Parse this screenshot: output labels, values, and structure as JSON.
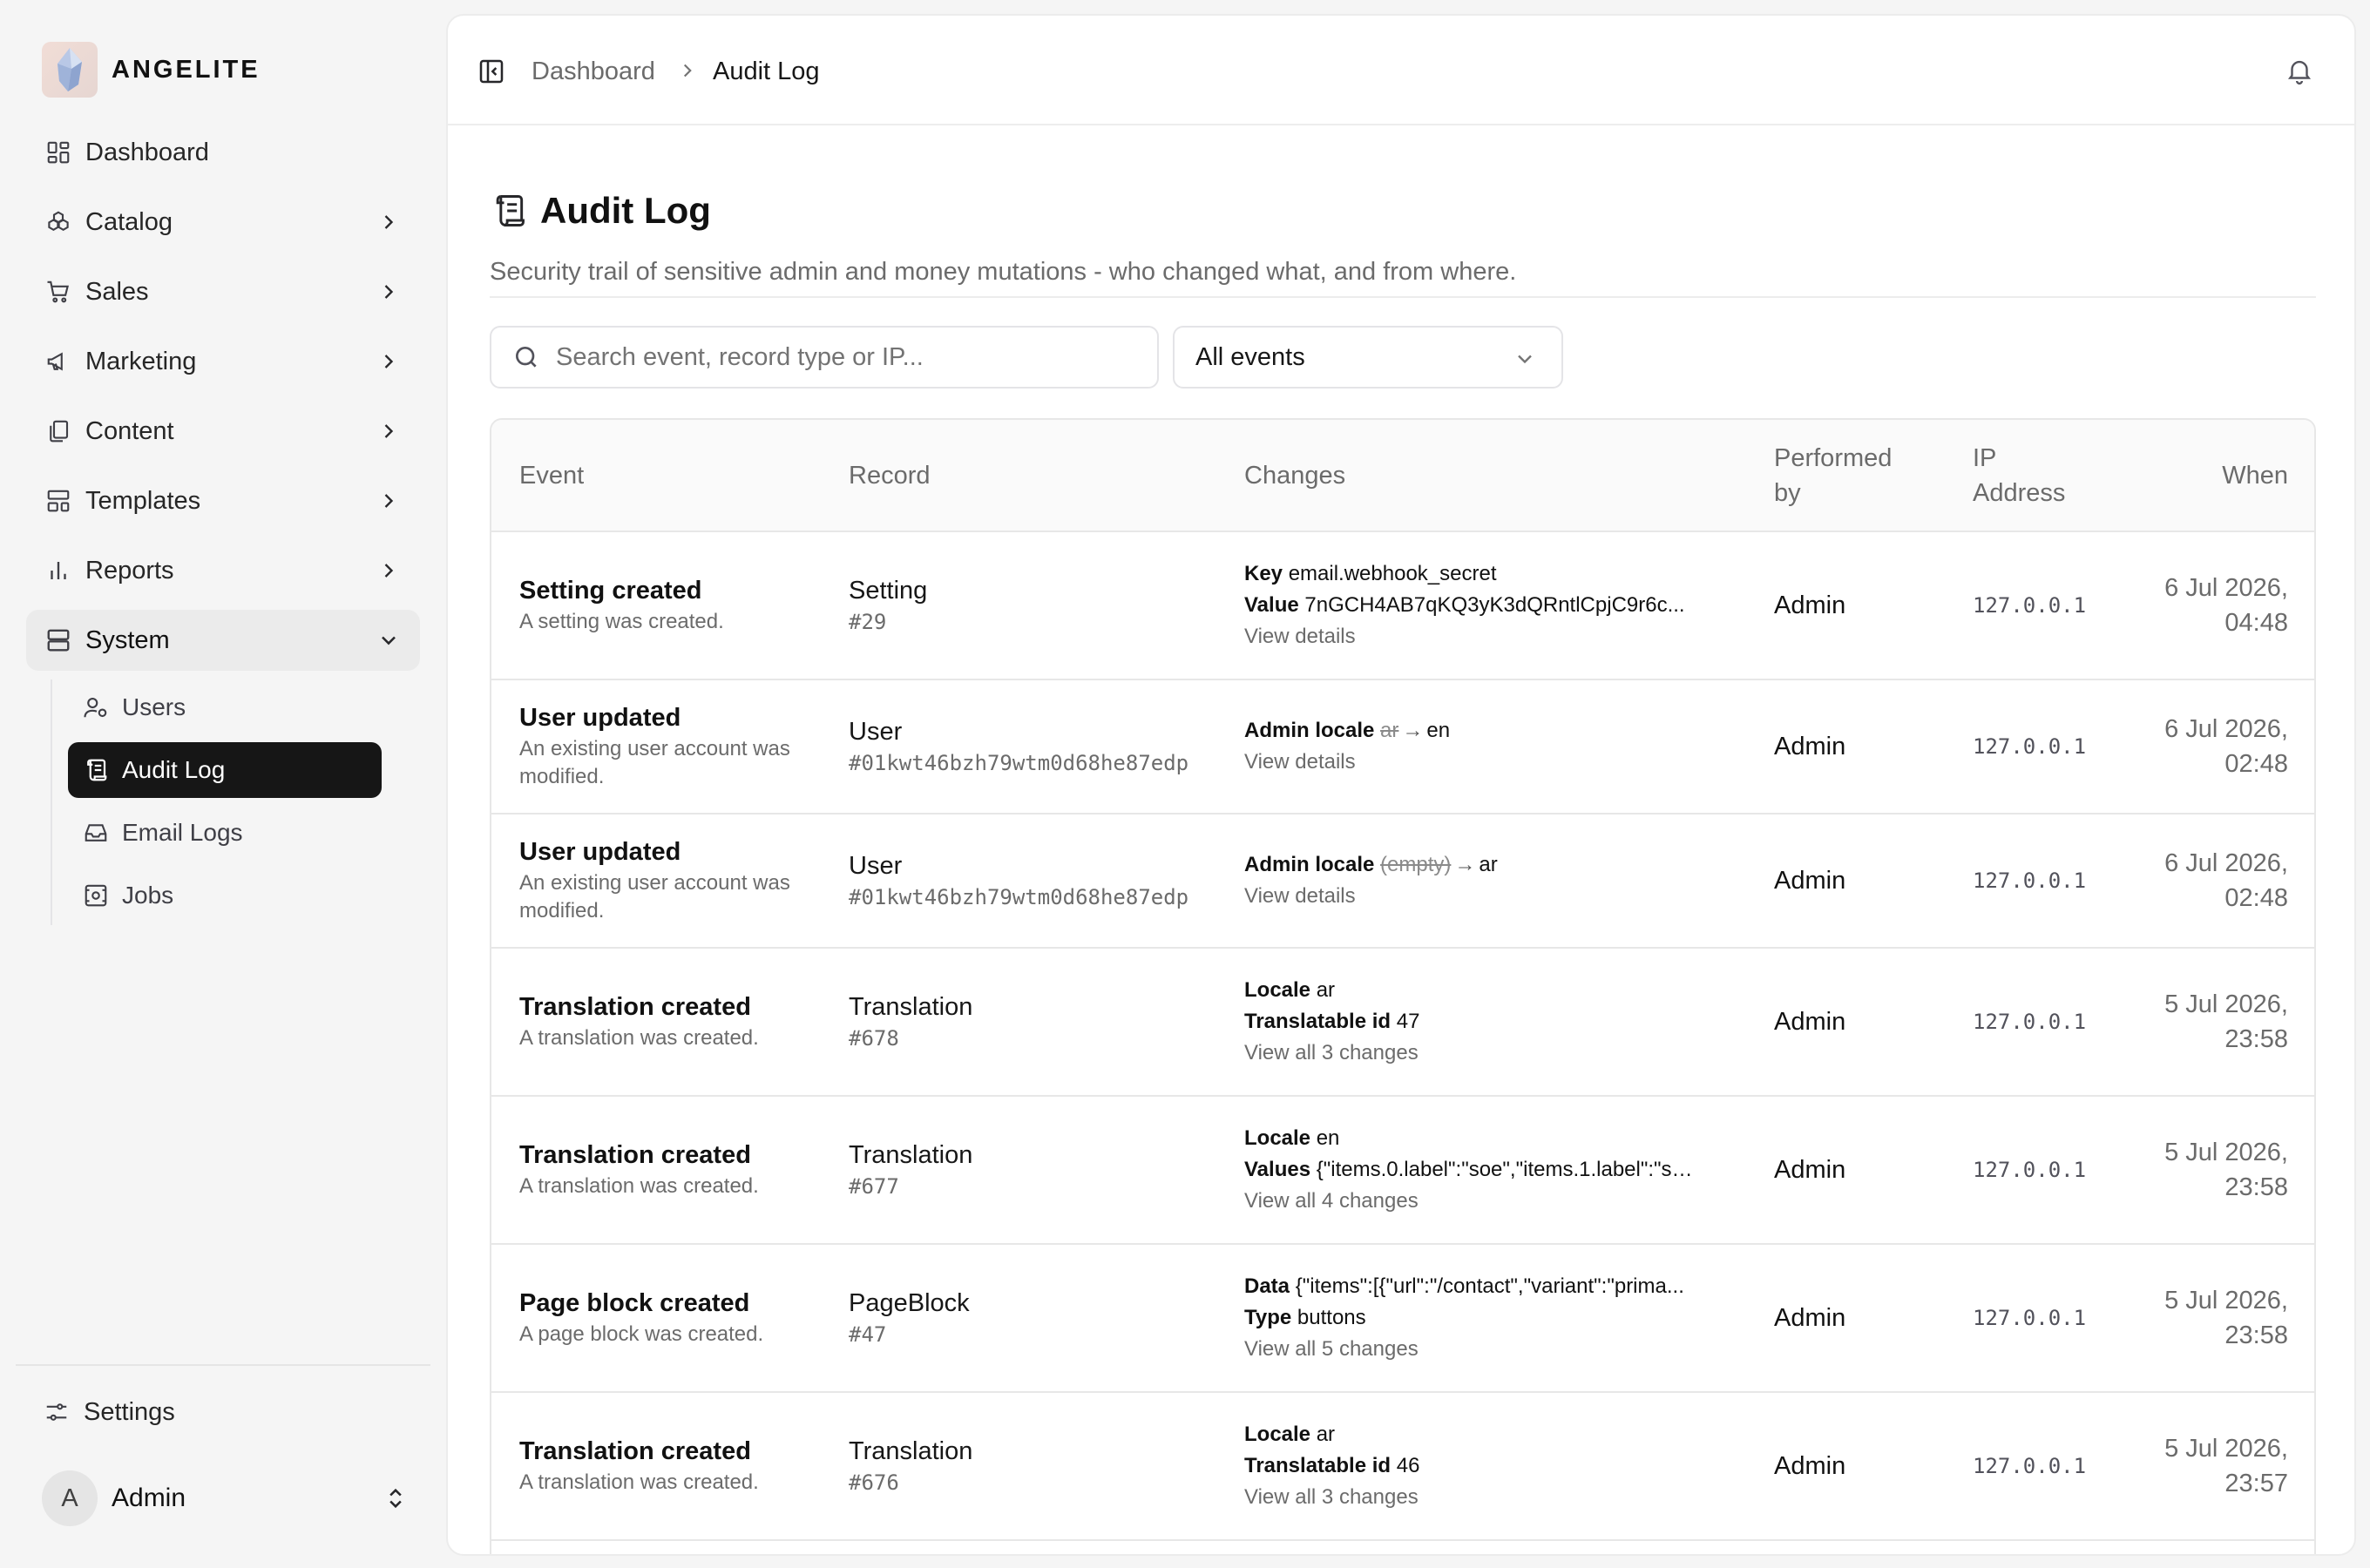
{
  "brand": {
    "name": "ANGELITE"
  },
  "sidebar": {
    "items": [
      {
        "label": "Dashboard",
        "icon": "dashboard-icon"
      },
      {
        "label": "Catalog",
        "icon": "catalog-icon"
      },
      {
        "label": "Sales",
        "icon": "cart-icon"
      },
      {
        "label": "Marketing",
        "icon": "megaphone-icon"
      },
      {
        "label": "Content",
        "icon": "files-icon"
      },
      {
        "label": "Templates",
        "icon": "templates-icon"
      },
      {
        "label": "Reports",
        "icon": "bar-chart-icon"
      },
      {
        "label": "System",
        "icon": "server-icon"
      }
    ],
    "system_children": [
      {
        "label": "Users",
        "icon": "users-icon"
      },
      {
        "label": "Audit Log",
        "icon": "scroll-icon",
        "active": true
      },
      {
        "label": "Email Logs",
        "icon": "inbox-icon"
      },
      {
        "label": "Jobs",
        "icon": "jobs-icon"
      }
    ],
    "settings_label": "Settings",
    "user": {
      "initial": "A",
      "name": "Admin"
    }
  },
  "breadcrumb": {
    "parent": "Dashboard",
    "current": "Audit Log"
  },
  "page": {
    "title": "Audit Log",
    "subtitle": "Security trail of sensitive admin and money mutations - who changed what, and from where."
  },
  "filters": {
    "search_placeholder": "Search event, record type or IP...",
    "event_select": "All events"
  },
  "table": {
    "headers": {
      "event": "Event",
      "record": "Record",
      "changes": "Changes",
      "performed_by": "Performed by",
      "ip": "IP Address",
      "when": "When"
    },
    "rows": [
      {
        "event": "Setting created",
        "event_desc": "A setting was created.",
        "record_type": "Setting",
        "record_id": "#29",
        "changes": [
          {
            "key": "Key",
            "value": "email.webhook_secret"
          },
          {
            "key": "Value",
            "value": "7nGCH4AB7qKQ3yK3dQRntlCpjC9r6c..."
          }
        ],
        "link": "View details",
        "by": "Admin",
        "ip": "127.0.0.1",
        "when_date": "6 Jul 2026,",
        "when_time": "04:48"
      },
      {
        "event": "User updated",
        "event_desc": "An existing user account was modified.",
        "record_type": "User",
        "record_id": "#01kwt46bzh79wtm0d68he87edp",
        "changes": [
          {
            "key": "Admin locale",
            "old": "ar",
            "arrow": "→",
            "value": "en"
          }
        ],
        "link": "View details",
        "by": "Admin",
        "ip": "127.0.0.1",
        "when_date": "6 Jul 2026,",
        "when_time": "02:48"
      },
      {
        "event": "User updated",
        "event_desc": "An existing user account was modified.",
        "record_type": "User",
        "record_id": "#01kwt46bzh79wtm0d68he87edp",
        "changes": [
          {
            "key": "Admin locale",
            "old": "(empty)",
            "arrow": "→",
            "value": "ar"
          }
        ],
        "link": "View details",
        "by": "Admin",
        "ip": "127.0.0.1",
        "when_date": "6 Jul 2026,",
        "when_time": "02:48"
      },
      {
        "event": "Translation created",
        "event_desc": "A translation was created.",
        "record_type": "Translation",
        "record_id": "#678",
        "changes": [
          {
            "key": "Locale",
            "value": "ar"
          },
          {
            "key": "Translatable id",
            "value": "47"
          }
        ],
        "link": "View all 3 changes",
        "by": "Admin",
        "ip": "127.0.0.1",
        "when_date": "5 Jul 2026,",
        "when_time": "23:58"
      },
      {
        "event": "Translation created",
        "event_desc": "A translation was created.",
        "record_type": "Translation",
        "record_id": "#677",
        "changes": [
          {
            "key": "Locale",
            "value": "en"
          },
          {
            "key": "Values",
            "value": "{\"items.0.label\":\"soe\",\"items.1.label\":\"se..."
          }
        ],
        "link": "View all 4 changes",
        "by": "Admin",
        "ip": "127.0.0.1",
        "when_date": "5 Jul 2026,",
        "when_time": "23:58"
      },
      {
        "event": "Page block created",
        "event_desc": "A page block was created.",
        "record_type": "PageBlock",
        "record_id": "#47",
        "changes": [
          {
            "key": "Data",
            "value": "{\"items\":[{\"url\":\"/contact\",\"variant\":\"prima..."
          },
          {
            "key": "Type",
            "value": "buttons"
          }
        ],
        "link": "View all 5 changes",
        "by": "Admin",
        "ip": "127.0.0.1",
        "when_date": "5 Jul 2026,",
        "when_time": "23:58"
      },
      {
        "event": "Translation created",
        "event_desc": "A translation was created.",
        "record_type": "Translation",
        "record_id": "#676",
        "changes": [
          {
            "key": "Locale",
            "value": "ar"
          },
          {
            "key": "Translatable id",
            "value": "46"
          }
        ],
        "link": "View all 3 changes",
        "by": "Admin",
        "ip": "127.0.0.1",
        "when_date": "5 Jul 2026,",
        "when_time": "23:57"
      }
    ]
  },
  "colors": {
    "active_nav_bg": "#161616",
    "page_bg": "#f5f5f5",
    "muted_text": "#6b6b6b"
  }
}
